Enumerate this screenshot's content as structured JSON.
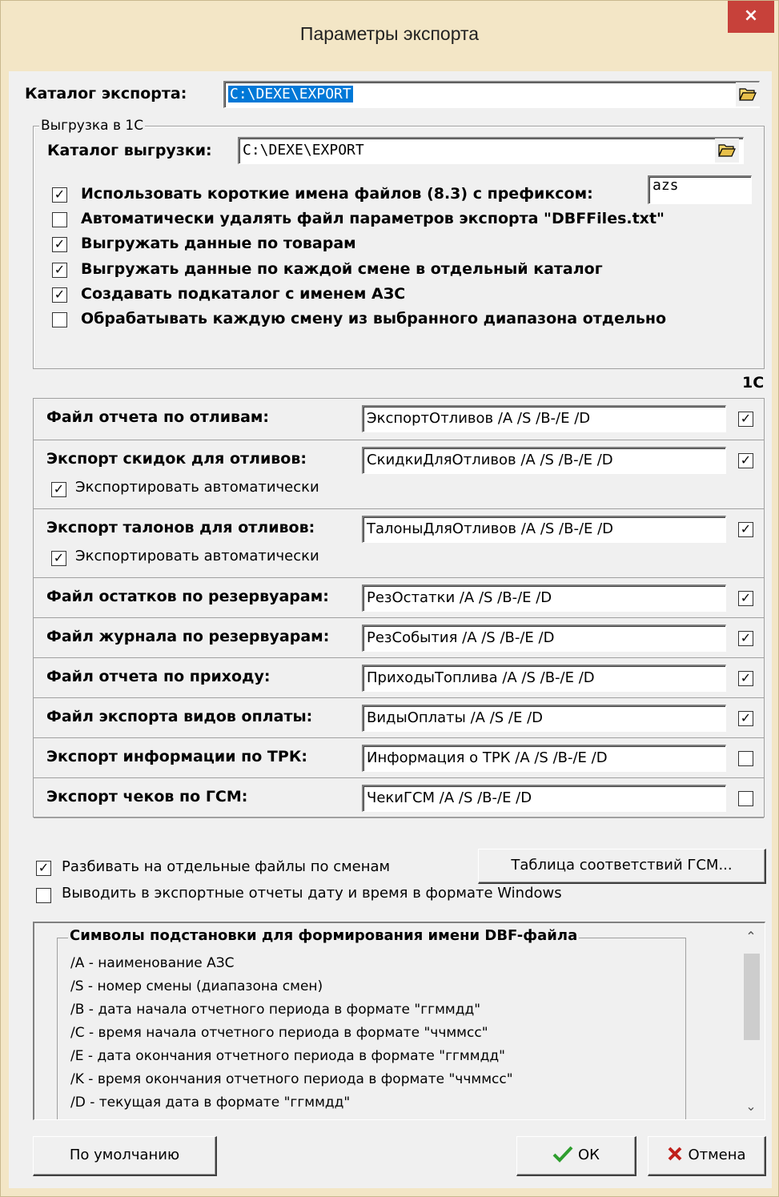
{
  "window": {
    "title": "Параметры экспорта",
    "close_glyph": "×"
  },
  "export_dir": {
    "label": "Каталог экспорта:",
    "value": "C:\\DEXE\\EXPORT"
  },
  "upload_1c": {
    "caption": "Выгрузка в 1С",
    "dir_label": "Каталог выгрузки:",
    "dir_value": "C:\\DEXE\\EXPORT",
    "prefix_value": "azs",
    "options": [
      {
        "label": "Использовать короткие имена файлов (8.3) с префиксом:",
        "checked": true
      },
      {
        "label": "Автоматически удалять файл параметров экспорта \"DBFFiles.txt\"",
        "checked": false
      },
      {
        "label": "Выгружать данные по товарам",
        "checked": true
      },
      {
        "label": "Выгружать данные по каждой смене в отдельный каталог",
        "checked": true
      },
      {
        "label": "Создавать подкаталог с именем АЗС",
        "checked": true
      },
      {
        "label": "Обрабатывать каждую смену из выбранного диапазона отдельно",
        "checked": false
      }
    ]
  },
  "files_header_1c": "1С",
  "files": [
    {
      "label": "Файл отчета по отливам:",
      "value": "ЭкспортОтливов /A /S /B-/E /D",
      "checked": true
    },
    {
      "label": "Экспорт скидок для отливов:",
      "value": "СкидкиДляОтливов /A /S /B-/E /D",
      "checked": true,
      "auto_label": "Экспортировать автоматически",
      "auto_checked": true
    },
    {
      "label": "Экспорт талонов для отливов:",
      "value": "ТалоныДляОтливов /A /S /B-/E /D",
      "checked": true,
      "auto_label": "Экспортировать автоматически",
      "auto_checked": true
    },
    {
      "label": "Файл остатков по резервуарам:",
      "value": "РезОстатки /A /S /B-/E /D",
      "checked": true
    },
    {
      "label": "Файл журнала по резервуарам:",
      "value": "РезСобытия /A /S /B-/E /D",
      "checked": true
    },
    {
      "label": "Файл отчета по приходу:",
      "value": "ПриходыТоплива /A /S /B-/E /D",
      "checked": true
    },
    {
      "label": "Файл экспорта видов оплаты:",
      "value": "ВидыОплаты /A /S /E /D",
      "checked": true
    },
    {
      "label": "Экспорт информации по ТРК:",
      "value": "Информация о ТРК /A /S /B-/E /D",
      "checked": false
    },
    {
      "label": "Экспорт чеков по ГСМ:",
      "value": "ЧекиГСМ  /A /S /B-/E /D",
      "checked": false
    }
  ],
  "split_by_shift": {
    "label": "Разбивать на отдельные файлы по сменам",
    "checked": true
  },
  "windows_datetime": {
    "label": "Выводить в экспортные отчеты дату и время в формате Windows",
    "checked": false
  },
  "gsm_table_button": "Таблица соответствий ГСМ...",
  "symbols": {
    "caption": "Символы подстановки для формирования имени DBF-файла",
    "lines": [
      "/A - наименование АЗС",
      "/S - номер смены (диапазона смен)",
      "/B - дата начала отчетного периода в формате \"ггммдд\"",
      "/C - время начала отчетного периода в формате \"ччммсс\"",
      "/E - дата окончания отчетного периода в формате \"ггммдд\"",
      "/K - время окончания отчетного периода в формате \"ччммсс\"",
      "/D - текущая дата в формате \"ггммдд\""
    ]
  },
  "buttons": {
    "default": "По умолчанию",
    "ok": "ОК",
    "cancel": "Отмена"
  },
  "colors": {
    "selection": "#0078d7",
    "close": "#c7413a",
    "ok_check": "#2e9e2e",
    "cancel_x": "#c0201a"
  },
  "icons": {
    "folder": "folder-open-icon",
    "ok": "checkmark-icon",
    "cancel": "cross-icon"
  }
}
